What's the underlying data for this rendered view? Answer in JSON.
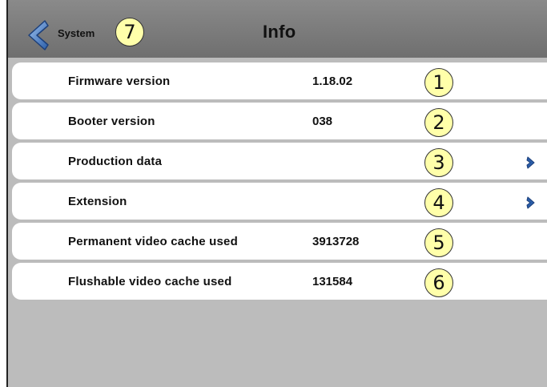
{
  "header": {
    "back_label": "System",
    "back_badge": "7",
    "title": "Info"
  },
  "rows": [
    {
      "label": "Firmware version",
      "value": "1.18.02",
      "badge": "1",
      "has_chevron": false
    },
    {
      "label": "Booter version",
      "value": "038",
      "badge": "2",
      "has_chevron": false
    },
    {
      "label": "Production data",
      "value": "",
      "badge": "3",
      "has_chevron": true
    },
    {
      "label": "Extension",
      "value": "",
      "badge": "4",
      "has_chevron": true
    },
    {
      "label": "Permanent video cache used",
      "value": "3913728",
      "badge": "5",
      "has_chevron": false
    },
    {
      "label": "Flushable video cache used",
      "value": "131584",
      "badge": "6",
      "has_chevron": false
    }
  ],
  "colors": {
    "titlebar": "#7d7d7d",
    "background": "#bcbcbc",
    "row": "#ffffff",
    "badge": "#ffffaa",
    "accent": "#2a5da8"
  },
  "icons": {
    "back": "back-arrow-icon",
    "chevron": "chevron-right-icon"
  }
}
